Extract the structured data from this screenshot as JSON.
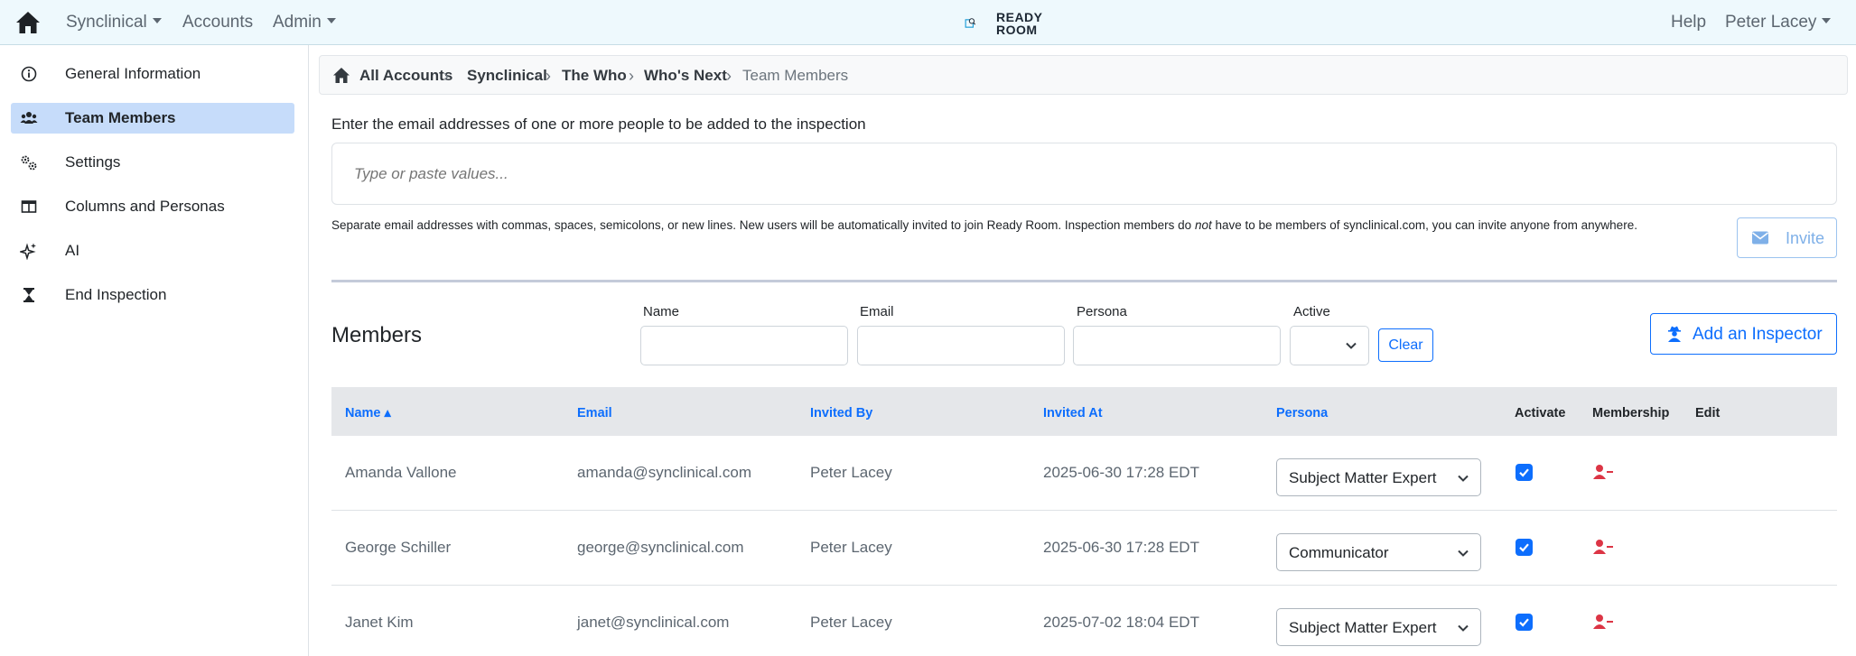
{
  "navbar": {
    "menu_synclinical": "Synclinical",
    "menu_accounts": "Accounts",
    "menu_admin": "Admin",
    "brand_line1": "READY",
    "brand_line2": "ROOM",
    "help": "Help",
    "user": "Peter Lacey"
  },
  "sidebar": {
    "items": [
      {
        "label": "General Information",
        "icon": "info-circle-icon"
      },
      {
        "label": "Team Members",
        "icon": "people-icon",
        "active": true
      },
      {
        "label": "Settings",
        "icon": "gears-icon"
      },
      {
        "label": "Columns and Personas",
        "icon": "table-columns-icon"
      },
      {
        "label": "AI",
        "icon": "sparkles-icon"
      },
      {
        "label": "End Inspection",
        "icon": "hourglass-icon"
      }
    ]
  },
  "breadcrumb": [
    "All Accounts",
    "Synclinical",
    "The Who",
    "Who's Next",
    "Team Members"
  ],
  "invite": {
    "prompt": "Enter the email addresses of one or more people to be added to the inspection",
    "placeholder": "Type or paste values...",
    "help_before": "Separate email addresses with commas, spaces, semicolons, or new lines. New users will be automatically invited to join Ready Room. Inspection members do ",
    "help_em": "not",
    "help_after": " have to be members of synclinical.com, you can invite anyone from anywhere.",
    "button": "Invite"
  },
  "members": {
    "title": "Members",
    "filters": {
      "name": "Name",
      "email": "Email",
      "persona": "Persona",
      "active": "Active"
    },
    "clear": "Clear",
    "add_button": "Add an Inspector"
  },
  "table": {
    "columns": [
      "Name ▴",
      "Email",
      "Invited By",
      "Invited At",
      "Persona",
      "Activate",
      "Membership",
      "Edit"
    ],
    "rows": [
      {
        "name": "Amanda Vallone",
        "email": "amanda@synclinical.com",
        "invited_by": "Peter Lacey",
        "invited_at": "2025-06-30 17:28 EDT",
        "persona": "Subject Matter Expert",
        "active": true
      },
      {
        "name": "George Schiller",
        "email": "george@synclinical.com",
        "invited_by": "Peter Lacey",
        "invited_at": "2025-06-30 17:28 EDT",
        "persona": "Communicator",
        "active": true
      },
      {
        "name": "Janet Kim",
        "email": "janet@synclinical.com",
        "invited_by": "Peter Lacey",
        "invited_at": "2025-07-02 18:04 EDT",
        "persona": "Subject Matter Expert",
        "active": true
      }
    ]
  },
  "colors": {
    "primary": "#0d6efd",
    "danger": "#dc3545",
    "navbar_bg": "#eef9fd",
    "active_sidebar": "#c6dcfa"
  }
}
